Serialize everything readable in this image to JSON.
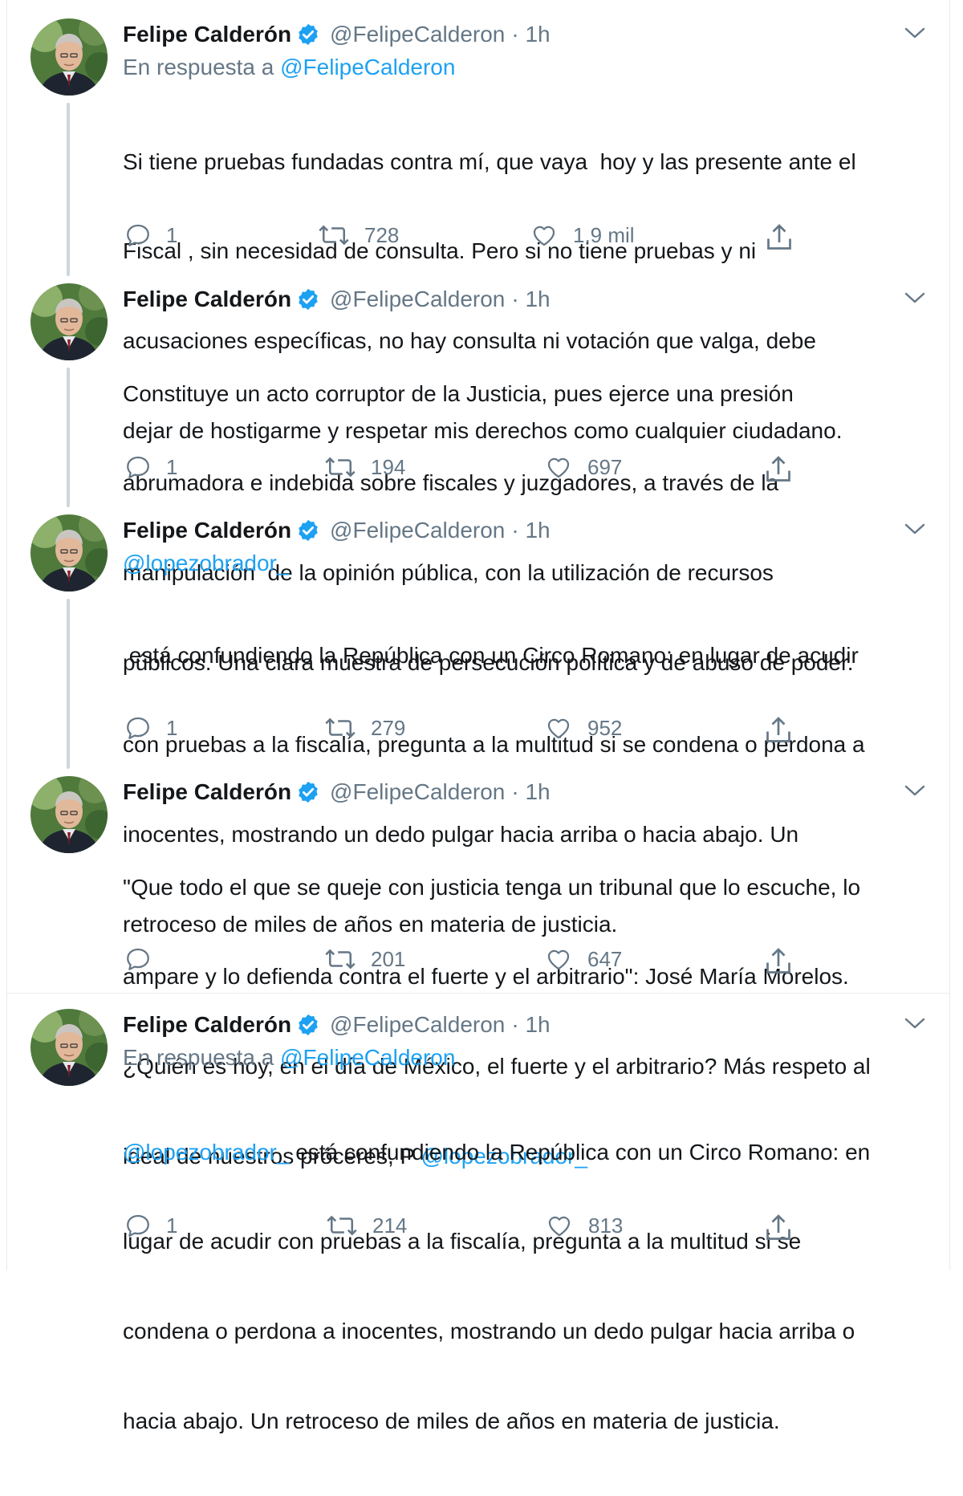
{
  "colors": {
    "link": "#1da1f2",
    "secondary": "#657786",
    "verified": "#1da1f2",
    "thread": "#ccd6dd"
  },
  "tweets": [
    {
      "name": "Felipe Calderón",
      "handle": "@FelipeCalderon",
      "time": "· 1h",
      "reply_prefix": "En respuesta a",
      "reply_handle": "@FelipeCalderon",
      "lines": [
        "Si tiene pruebas fundadas contra mí, que vaya  hoy y las presente ante el",
        "Fiscal , sin necesidad de consulta. Pero si no tiene pruebas y ni",
        "acusaciones específicas, no hay consulta ni votación que valga, debe",
        "dejar de hostigarme y respetar mis derechos como cualquier ciudadano."
      ],
      "replies": "1",
      "retweets": "728",
      "likes": "1,9 mil"
    },
    {
      "name": "Felipe Calderón",
      "handle": "@FelipeCalderon",
      "time": "· 1h",
      "lines": [
        "Constituye un acto corruptor de la Justicia, pues ejerce una presión",
        "abrumadora e indebida sobre fiscales y juzgadores, a través de la",
        "manipulación  de la opinión pública, con la utilización de recursos",
        "públicos. Una clara muestra de persecución política y de abuso de poder."
      ],
      "replies": "1",
      "retweets": "194",
      "likes": "697"
    },
    {
      "name": "Felipe Calderón",
      "handle": "@FelipeCalderon",
      "time": "· 1h",
      "mention": "@lopezobrador_",
      "lines": [
        " está confundiendo la República con un Circo Romano: en lugar de acudir",
        "con pruebas a la fiscalía, pregunta a la multitud si se condena o perdona a",
        "inocentes, mostrando un dedo pulgar hacia arriba o hacia abajo. Un",
        "retroceso de miles de años en materia de justicia."
      ],
      "replies": "1",
      "retweets": "279",
      "likes": "952"
    },
    {
      "name": "Felipe Calderón",
      "handle": "@FelipeCalderon",
      "time": "· 1h",
      "lines": [
        "\"Que todo el que se queje con justicia tenga un tribunal que lo escuche, lo",
        "ampare y lo defienda contra el fuerte y el arbitrario\": José María Morelos.",
        "¿Quién es hoy, en el día de México, el fuerte y el arbitrario? Más respeto al"
      ],
      "last_line_text": "ideal de nuestros próceres, P ",
      "last_line_mention": "@lopezobrador_",
      "replies": "",
      "retweets": "201",
      "likes": "647"
    },
    {
      "name": "Felipe Calderón",
      "handle": "@FelipeCalderon",
      "time": "· 1h",
      "reply_prefix": "En respuesta a",
      "reply_handle": "@FelipeCalderon",
      "first_line_mention": "@lopezobrador_",
      "first_line_text": " está confundiendo la República con un Circo Romano: en",
      "lines": [
        "lugar de acudir con pruebas a la fiscalía, pregunta a la multitud si se",
        "condena o perdona a inocentes, mostrando un dedo pulgar hacia arriba o",
        "hacia abajo. Un retroceso de miles de años en materia de justicia."
      ],
      "replies": "1",
      "retweets": "214",
      "likes": "813"
    }
  ]
}
